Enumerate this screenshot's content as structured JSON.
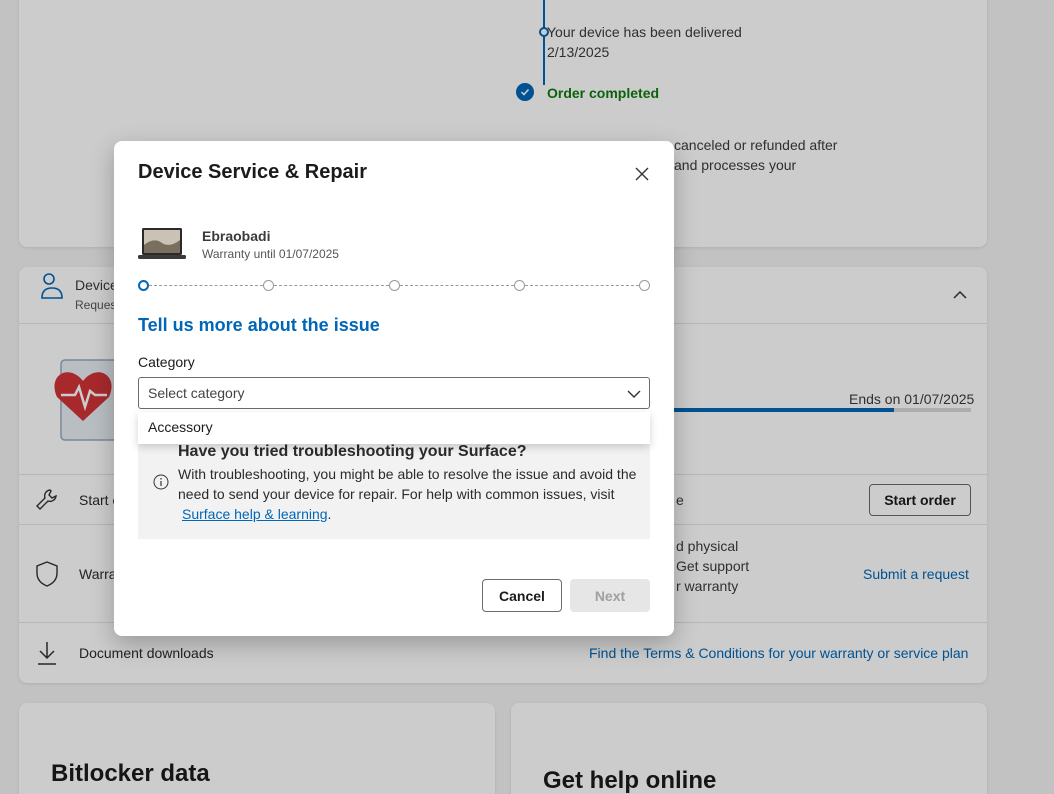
{
  "background": {
    "timeline": {
      "delivered_text": "Your device has been delivered",
      "delivered_date": "2/13/2025",
      "completed_text": "Order completed",
      "note_line1": "canceled or refunded after",
      "note_line2": "and processes your"
    },
    "device_section": {
      "title_partial": "Device",
      "subtitle_partial": "Reques",
      "ends_on": "Ends on 01/07/2025",
      "coverage_progress": 0.74,
      "rows": [
        {
          "label": "Start o",
          "right_fragment": "e",
          "action": "Start order"
        },
        {
          "label": "Warra",
          "fragments": [
            "d physical",
            "Get support",
            "r warranty"
          ],
          "action": "Submit a request"
        },
        {
          "label": "Document downloads",
          "action": "Find the Terms & Conditions for your warranty or service plan"
        }
      ]
    },
    "bitlocker_title": "Bitlocker data",
    "help_title": "Get help online"
  },
  "modal": {
    "title": "Device Service & Repair",
    "device_name": "Ebraobadi",
    "warranty": "Warranty until 01/07/2025",
    "steps_total": 5,
    "current_step": 1,
    "section_heading": "Tell us more about the issue",
    "category_label": "Category",
    "category_placeholder": "Select category",
    "dropdown_options": [
      "Accessory"
    ],
    "tip": {
      "title": "Have you tried troubleshooting your Surface?",
      "body": "With troubleshooting, you might be able to resolve the issue and avoid the need to send your device for repair. For help with common issues, visit",
      "link": "Surface help & learning",
      "suffix": "."
    },
    "cancel_label": "Cancel",
    "next_label": "Next"
  },
  "colors": {
    "accent": "#0067b8",
    "success": "#107c10",
    "health_heart": "#d13438"
  }
}
